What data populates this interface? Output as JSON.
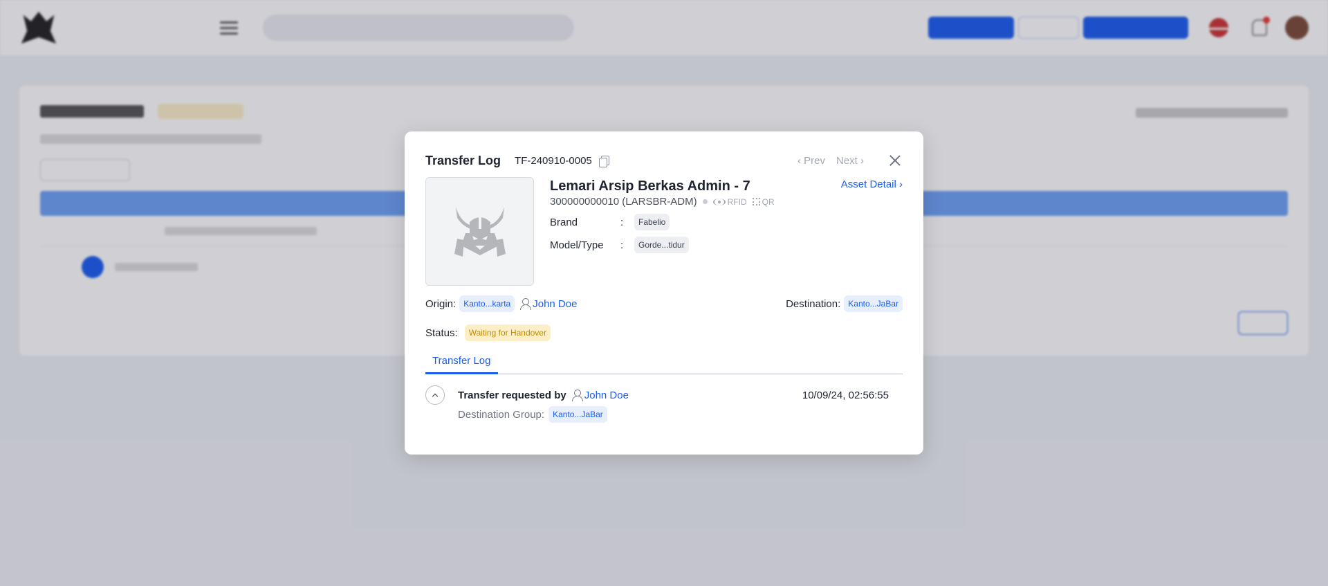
{
  "modal": {
    "title": "Transfer Log",
    "code": "TF-240910-0005",
    "prev_label": "‹ Prev",
    "next_label": "Next ›",
    "asset": {
      "name": "Lemari Arsip Berkas Admin - 7",
      "code": "300000000010 (LARSBR-ADM)",
      "rfid_label": "RFID",
      "qr_label": "QR",
      "brand_label": "Brand",
      "brand_value": "Fabelio",
      "model_label": "Model/Type",
      "model_value": "Gorde...tidur",
      "colon": ":",
      "detail_link": "Asset Detail ›"
    },
    "origin_label": "Origin:",
    "origin_value": "Kanto...karta",
    "origin_person": "John Doe",
    "destination_label": "Destination:",
    "destination_value": "Kanto...JaBar",
    "status_label": "Status:",
    "status_value": "Waiting for Handover",
    "tabs": [
      {
        "label": "Transfer Log"
      }
    ],
    "log": [
      {
        "action": "Transfer requested by",
        "person": "John Doe",
        "time": "10/09/24, 02:56:55",
        "detail_label": "Destination Group:",
        "detail_value": "Kanto...JaBar"
      }
    ]
  },
  "colors": {
    "accent": "#1a5cf0",
    "status_yellow": "#c28a00"
  }
}
